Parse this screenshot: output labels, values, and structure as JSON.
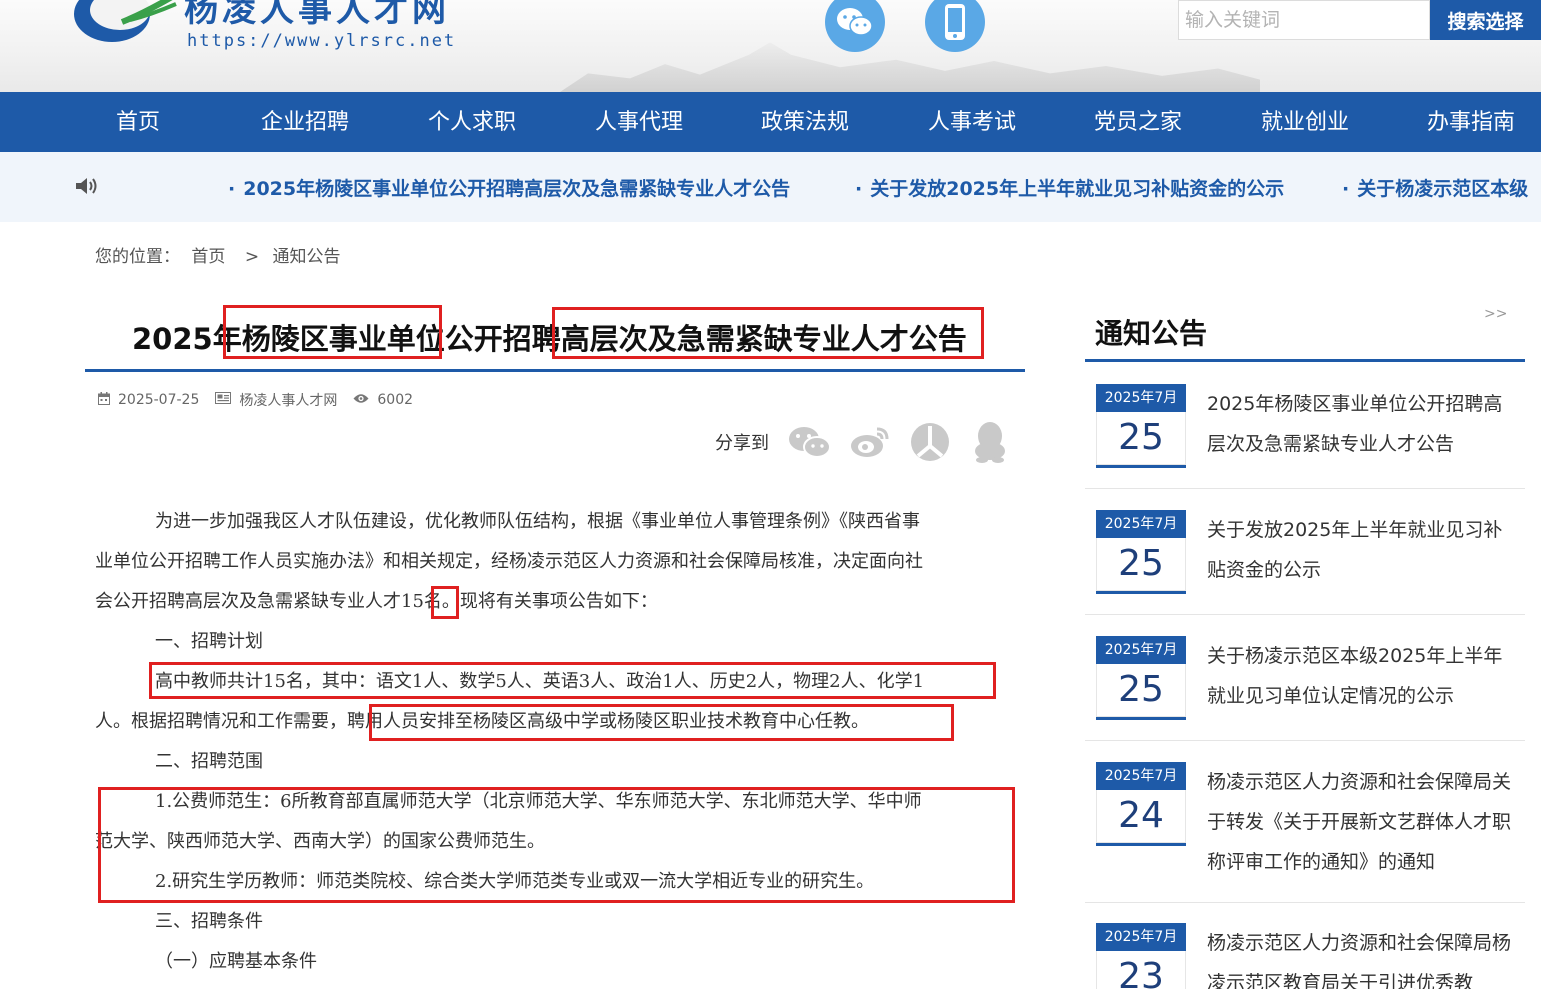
{
  "header": {
    "site_name": "杨凌人事人才网",
    "site_url": "https://www.ylrsrc.net",
    "search_placeholder": "输入关键词",
    "search_button": "搜索选择",
    "icons": [
      "wechat-icon",
      "mobile-icon"
    ]
  },
  "nav": {
    "items": [
      "首页",
      "企业招聘",
      "个人求职",
      "人事代理",
      "政策法规",
      "人事考试",
      "党员之家",
      "就业创业",
      "办事指南"
    ]
  },
  "ticker": {
    "items": [
      "2025年杨陵区事业单位公开招聘高层次及急需紧缺专业人才公告",
      "关于发放2025年上半年就业见习补贴资金的公示",
      "关于杨凌示范区本级"
    ]
  },
  "breadcrumb": {
    "label": "您的位置：",
    "home": "首页",
    "separator": ">",
    "current": "通知公告"
  },
  "article": {
    "title": "2025年杨陵区事业单位公开招聘高层次及急需紧缺专业人才公告",
    "date": "2025-07-25",
    "source": "杨凌人事人才网",
    "views": "6002",
    "share_label": "分享到",
    "paragraphs": [
      "为进一步加强我区人才队伍建设，优化教师队伍结构，根据《事业单位人事管理条例》《陕西省事",
      "业单位公开招聘工作人员实施办法》和相关规定，经杨凌示范区人力资源和社会保障局核准，决定面向社",
      "会公开招聘高层次及急需紧缺专业人才15名。现将有关事项公告如下：",
      "一、招聘计划",
      "高中教师共计15名，其中：语文1人、数学5人、英语3人、政治1人、历史2人，物理2人、化学1",
      "人。根据招聘情况和工作需要，聘用人员安排至杨陵区高级中学或杨陵区职业技术教育中心任教。",
      "二、招聘范围",
      "1.公费师范生：6所教育部直属师范大学（北京师范大学、华东师范大学、东北师范大学、华中师",
      "范大学、陕西师范大学、西南大学）的国家公费师范生。",
      "2.研究生学历教师：师范类院校、综合类大学师范类专业或双一流大学相近专业的研究生。",
      "三、招聘条件",
      "（一）应聘基本条件"
    ]
  },
  "sidebar": {
    "title": "通知公告",
    "more": ">>",
    "notices": [
      {
        "ym": "2025年7月",
        "day": "25",
        "text": "2025年杨陵区事业单位公开招聘高层次及急需紧缺专业人才公告"
      },
      {
        "ym": "2025年7月",
        "day": "25",
        "text": "关于发放2025年上半年就业见习补贴资金的公示"
      },
      {
        "ym": "2025年7月",
        "day": "25",
        "text": "关于杨凌示范区本级2025年上半年就业见习单位认定情况的公示"
      },
      {
        "ym": "2025年7月",
        "day": "24",
        "text": "杨凌示范区人力资源和社会保障局关于转发《关于开展新文艺群体人才职称评审工作的通知》的通知"
      },
      {
        "ym": "2025年7月",
        "day": "23",
        "text": "杨凌示范区人力资源和社会保障局杨凌示范区教育局关于引进优秀教"
      }
    ]
  },
  "colors": {
    "brand_blue": "#1e5aa8",
    "highlight_red": "#e02020",
    "ticker_bg": "#f0f5fb"
  }
}
